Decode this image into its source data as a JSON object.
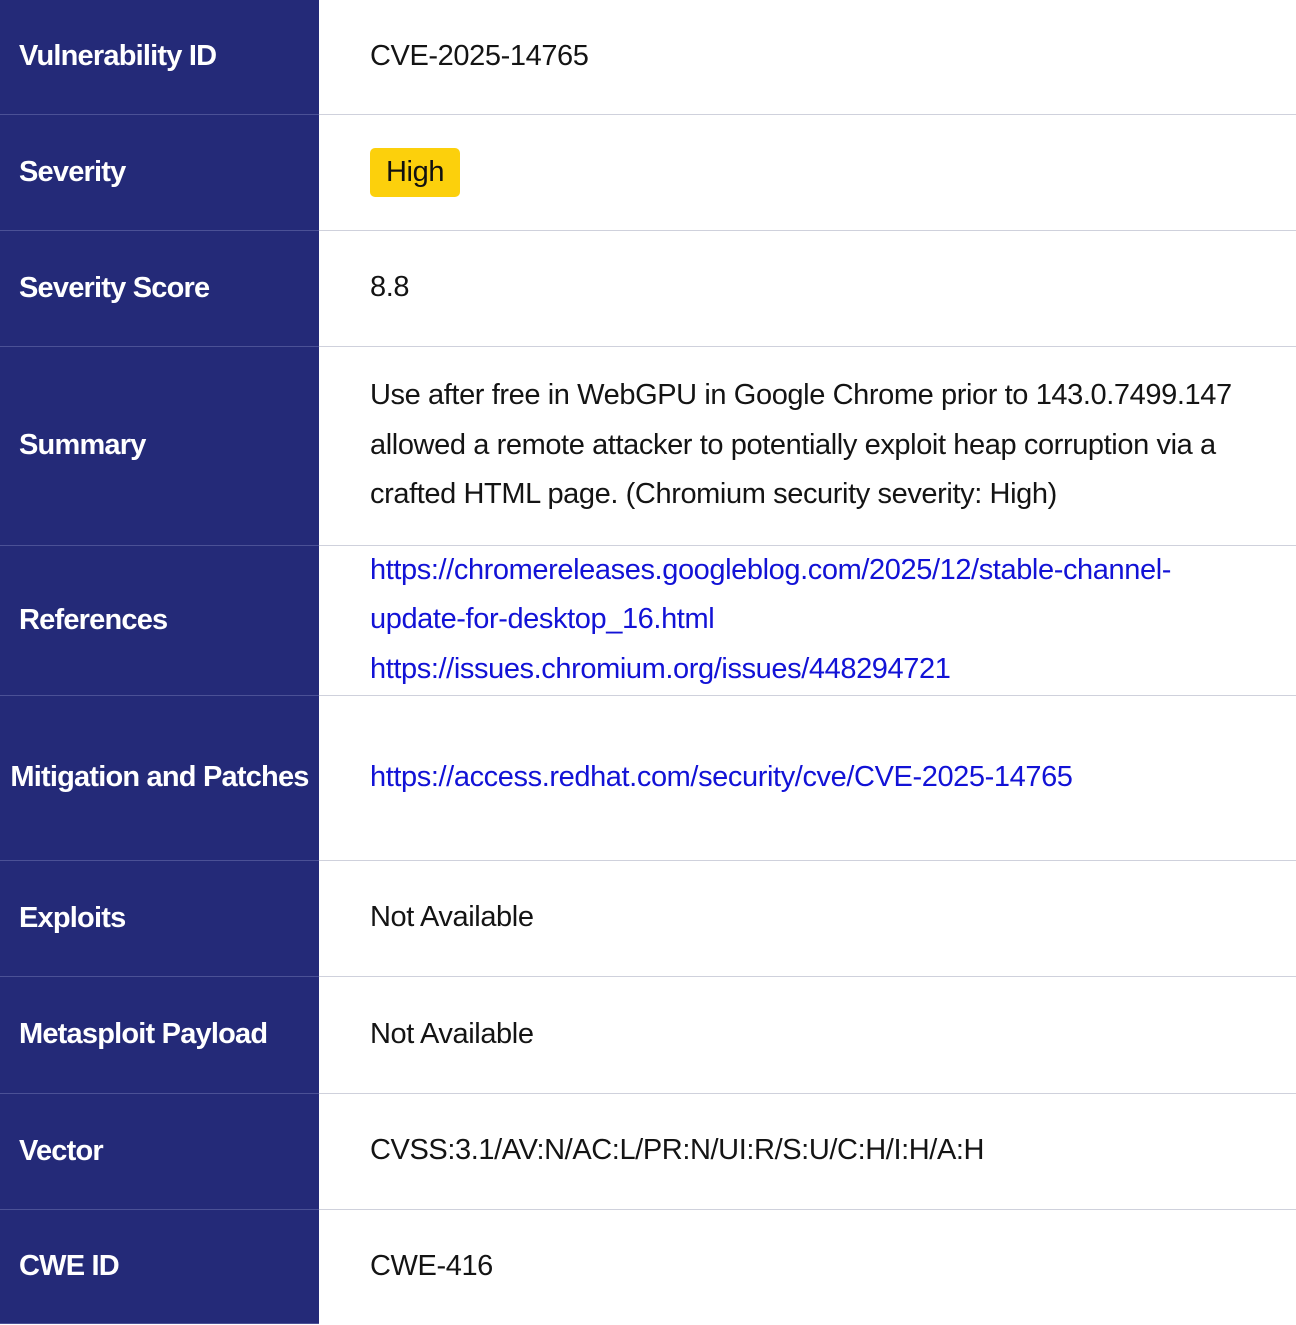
{
  "rows": {
    "vulnerability_id": {
      "label": "Vulnerability ID",
      "value": "CVE-2025-14765"
    },
    "severity": {
      "label": "Severity",
      "value": "High",
      "badge_color": "#fcd00c"
    },
    "severity_score": {
      "label": "Severity Score",
      "value": "8.8"
    },
    "summary": {
      "label": "Summary",
      "value": "Use after free in WebGPU in Google Chrome prior to 143.0.7499.147 allowed a remote attacker to potentially exploit heap corruption via a crafted HTML page. (Chromium security severity: High)"
    },
    "references": {
      "label": "References",
      "links": [
        "https://chromereleases.googleblog.com/2025/12/stable-channel-update-for-desktop_16.html",
        "https://issues.chromium.org/issues/448294721"
      ]
    },
    "mitigation": {
      "label": "Mitigation and Patches",
      "links": [
        "https://access.redhat.com/security/cve/CVE-2025-14765"
      ]
    },
    "exploits": {
      "label": "Exploits",
      "value": "Not Available"
    },
    "metasploit": {
      "label": "Metasploit Payload",
      "value": "Not Available"
    },
    "vector": {
      "label": "Vector",
      "value": "CVSS:3.1/AV:N/AC:L/PR:N/UI:R/S:U/C:H/I:H/A:H"
    },
    "cwe_id": {
      "label": "CWE ID",
      "value": "CWE-416"
    }
  },
  "colors": {
    "header_bg": "#242a78",
    "header_text": "#ffffff",
    "link": "#1212d6",
    "divider": "#cfd1dc"
  }
}
